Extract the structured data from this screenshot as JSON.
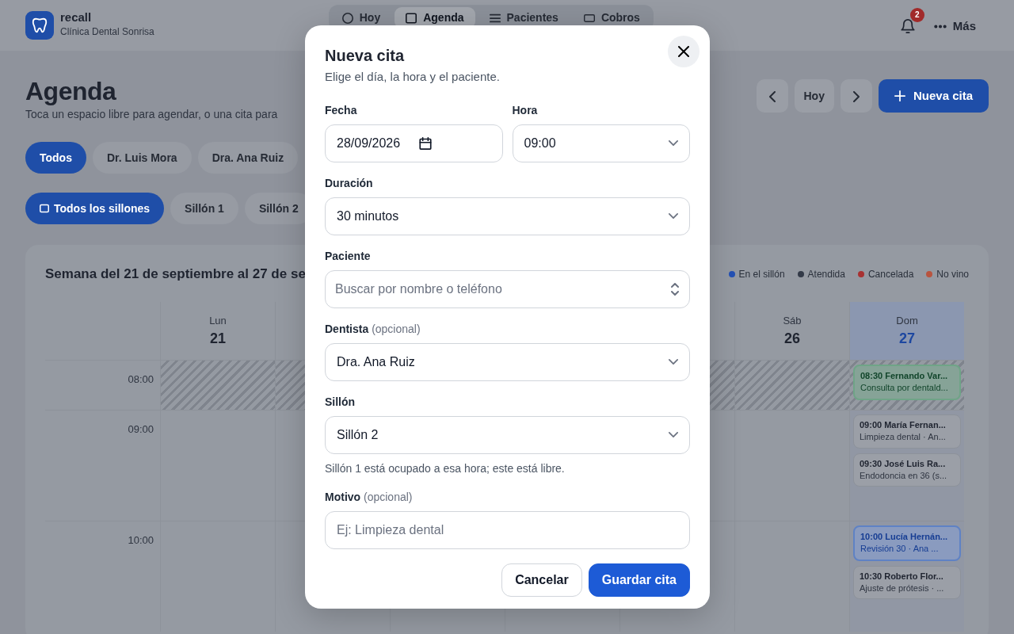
{
  "app": {
    "name": "recall",
    "clinic": "Clínica Dental Sonrisa"
  },
  "nav": [
    {
      "label": "Hoy",
      "selected": false
    },
    {
      "label": "Agenda",
      "selected": true
    },
    {
      "label": "Pacientes",
      "selected": false
    },
    {
      "label": "Cobros",
      "selected": false
    }
  ],
  "notifications": {
    "count": "2"
  },
  "more": "Más",
  "page": {
    "title": "Agenda",
    "subtitle": "Toca un espacio libre para agendar, o una cita para"
  },
  "toolbar": {
    "today": "Hoy",
    "new_button": "Nueva cita"
  },
  "dentist_filters": [
    {
      "label": "Todos",
      "selected": true
    },
    {
      "label": "Dr. Luis Mora",
      "selected": false
    },
    {
      "label": "Dra. Ana Ruiz",
      "selected": false
    }
  ],
  "chair_filters": [
    {
      "label": "Todos los sillones",
      "selected": true
    },
    {
      "label": "Sillón 1",
      "selected": false
    },
    {
      "label": "Sillón 2",
      "selected": false
    }
  ],
  "calendar": {
    "title": "Semana del 21 de septiembre al 27 de se",
    "legend": [
      {
        "label": "En el sillón",
        "color": "#2451b5"
      },
      {
        "label": "Atendida",
        "color": "#333a48"
      },
      {
        "label": "Cancelada",
        "color": "#a83232"
      },
      {
        "label": "No vino",
        "color": "#b8543f"
      }
    ],
    "hours": [
      {
        "label": "08:00",
        "closed": true
      },
      {
        "label": "09:00",
        "closed": false
      },
      {
        "label": "10:00",
        "closed": false
      }
    ],
    "days": [
      {
        "weekday": "Lun",
        "day": "21",
        "today": false
      },
      {
        "weekday": "Sáb",
        "day": "26",
        "today": false
      },
      {
        "weekday": "Dom",
        "day": "27",
        "today": true,
        "slots": [
          [
            {
              "kind": "confirmed",
              "line1": "08:30 Fernando Var...",
              "line2": "Consulta por dentald..."
            }
          ],
          [
            {
              "kind": "scheduled",
              "line1": "09:00 María Fernan...",
              "line2": "Limpieza dental · An..."
            },
            {
              "kind": "scheduled",
              "line1": "09:30 José Luis Ra...",
              "line2": "Endodoncia en 36 (s..."
            }
          ],
          [
            {
              "kind": "in_chair",
              "line1": "10:00 Lucía Hernán...",
              "line2": "Revisión 30 · Ana ..."
            },
            {
              "kind": "scheduled",
              "line1": "10:30 Roberto Flor...",
              "line2": "Ajuste de prótesis · ..."
            }
          ]
        ]
      }
    ]
  },
  "dialog": {
    "title": "Nueva cita",
    "subtitle": "Elige el día, la hora y el paciente.",
    "rows": [
      [
        {
          "kind": "date",
          "label": "Fecha",
          "value": "28/09/2026"
        },
        {
          "kind": "select",
          "label": "Hora",
          "value": "09:00"
        }
      ],
      [
        {
          "kind": "select",
          "label": "Duración",
          "value": "30 minutos"
        }
      ],
      [
        {
          "kind": "combo",
          "label": "Paciente",
          "placeholder": "Buscar por nombre o teléfono"
        }
      ],
      [
        {
          "kind": "select",
          "label": "Dentista",
          "hint": "(opcional)",
          "value": "Dra. Ana Ruiz"
        }
      ],
      [
        {
          "kind": "select",
          "label": "Sillón",
          "value": "Sillón 2",
          "help": "Sillón 1 está ocupado a esa hora; este está libre."
        }
      ],
      [
        {
          "kind": "text",
          "label": "Motivo",
          "hint": "(opcional)",
          "placeholder": "Ej: Limpieza dental"
        }
      ]
    ],
    "buttons": [
      {
        "kind": "secondary",
        "label": "Cancelar"
      },
      {
        "kind": "primary",
        "label": "Guardar cita"
      }
    ]
  }
}
